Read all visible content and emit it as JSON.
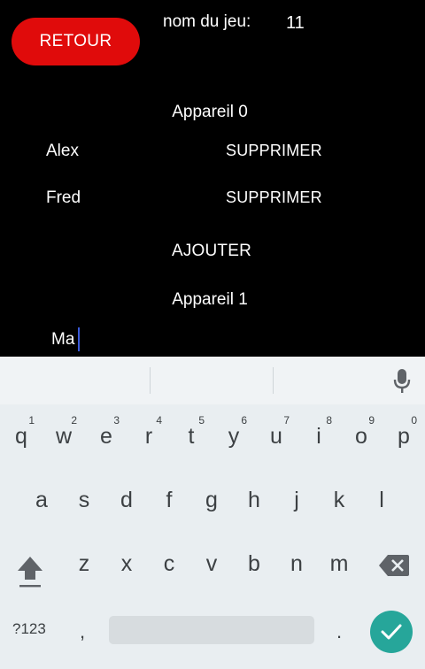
{
  "header": {
    "back_label": "RETOUR",
    "game_name_label": "nom du jeu:",
    "game_name_value": "11"
  },
  "devices": [
    {
      "title": "Appareil 0",
      "players": [
        {
          "name": "Alex",
          "delete_label": "SUPPRIMER"
        },
        {
          "name": "Fred",
          "delete_label": "SUPPRIMER"
        }
      ],
      "add_label": "AJOUTER"
    },
    {
      "title": "Appareil 1",
      "input_value": "Ma"
    }
  ],
  "keyboard": {
    "row1": [
      {
        "key": "q",
        "hint": "1"
      },
      {
        "key": "w",
        "hint": "2"
      },
      {
        "key": "e",
        "hint": "3"
      },
      {
        "key": "r",
        "hint": "4"
      },
      {
        "key": "t",
        "hint": "5"
      },
      {
        "key": "y",
        "hint": "6"
      },
      {
        "key": "u",
        "hint": "7"
      },
      {
        "key": "i",
        "hint": "8"
      },
      {
        "key": "o",
        "hint": "9"
      },
      {
        "key": "p",
        "hint": "0"
      }
    ],
    "row2": [
      "a",
      "s",
      "d",
      "f",
      "g",
      "h",
      "j",
      "k",
      "l"
    ],
    "row3": [
      "z",
      "x",
      "c",
      "v",
      "b",
      "n",
      "m"
    ],
    "symbols_label": "?123",
    "comma": ",",
    "period": ".",
    "accent_color": "#26a69a",
    "icons": {
      "mic": "microphone-icon",
      "shift": "shift-icon",
      "backspace": "backspace-icon",
      "enter": "checkmark-icon"
    }
  },
  "colors": {
    "back_button": "#e00b0b",
    "caret": "#3b5bdb",
    "background": "#000000"
  }
}
